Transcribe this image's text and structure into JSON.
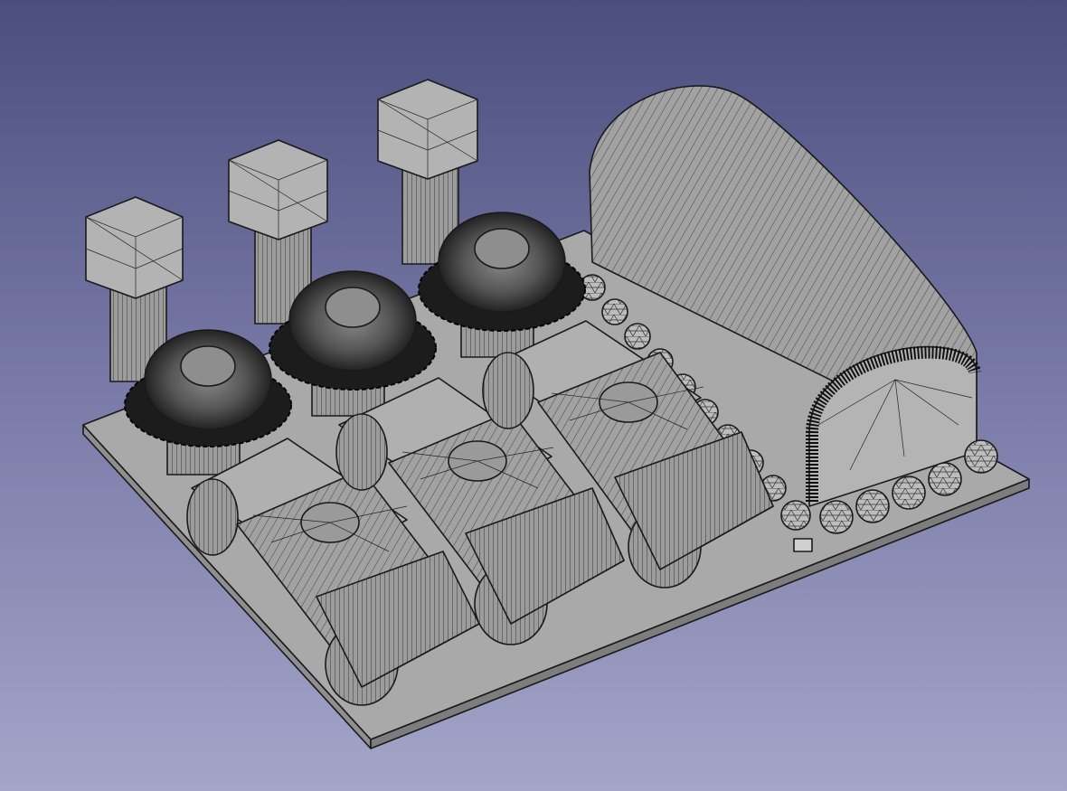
{
  "view": {
    "type": "3d-mesh-viewport",
    "background_top": "#4b4e7e",
    "background_bottom": "#a3a5c8",
    "shape_color": "#a0a0a0",
    "edge_color": "#1a1a1a"
  },
  "scene": {
    "objects": [
      "base-plate",
      "hex-bolt",
      "hex-bolt",
      "hex-bolt",
      "gear-washer",
      "gear-washer",
      "gear-washer",
      "clamp-block",
      "clamp-block",
      "clamp-block",
      "half-cylinder",
      "bead-chain"
    ]
  }
}
